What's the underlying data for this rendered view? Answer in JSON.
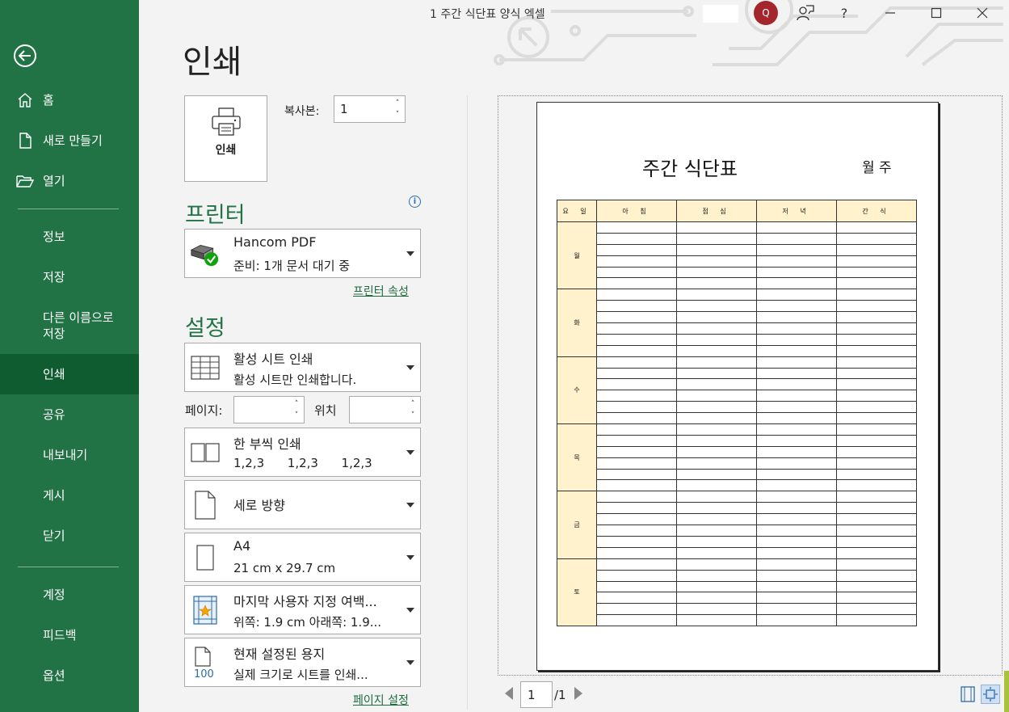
{
  "window": {
    "title": "1 주간 식단표 양식 엑셀",
    "account_initial": "Q",
    "help_label": "?"
  },
  "sidebar": {
    "items": [
      {
        "label": "홈"
      },
      {
        "label": "새로 만들기"
      },
      {
        "label": "열기"
      },
      {
        "label": "정보"
      },
      {
        "label": "저장"
      },
      {
        "label": "다른 이름으로\n저장"
      },
      {
        "label": "인쇄"
      },
      {
        "label": "공유"
      },
      {
        "label": "내보내기"
      },
      {
        "label": "게시"
      },
      {
        "label": "닫기"
      },
      {
        "label": "계정"
      },
      {
        "label": "피드백"
      },
      {
        "label": "옵션"
      }
    ]
  },
  "print": {
    "heading": "인쇄",
    "print_button_label": "인쇄",
    "copies_label": "복사본:",
    "copies_value": "1"
  },
  "printer": {
    "section_title": "프린터",
    "name": "Hancom PDF",
    "status": "준비: 1개 문서 대기 중",
    "properties_link": "프린터 속성"
  },
  "settings": {
    "section_title": "설정",
    "scope": {
      "title": "활성 시트 인쇄",
      "subtitle": "활성 시트만 인쇄합니다."
    },
    "pages_label": "페이지:",
    "pages_from": "",
    "to_label": "위치",
    "pages_to": "",
    "collate": {
      "title": "한 부씩 인쇄",
      "subtitle": "1,2,3      1,2,3      1,2,3"
    },
    "orientation": {
      "title": "세로 방향"
    },
    "paper": {
      "title": "A4",
      "subtitle": "21 cm x 29.7 cm"
    },
    "margins": {
      "title": "마지막 사용자 지정 여백...",
      "subtitle": "위쪽: 1.9 cm 아래쪽: 1.9..."
    },
    "scaling": {
      "title": "현재 설정된 용지",
      "subtitle": "실제 크기로 시트를 인쇄...",
      "icon_text": "100"
    },
    "page_setup_link": "페이지 설정"
  },
  "preview": {
    "sheet_title": "주간 식단표",
    "sheet_week": "월 주",
    "columns": [
      "요 일",
      "아 침",
      "점 심",
      "저 녁",
      "간 식"
    ],
    "days": [
      "월",
      "화",
      "수",
      "목",
      "금",
      "토"
    ],
    "rows_per_day": 6,
    "current_page": "1",
    "total_pages": "/1"
  }
}
